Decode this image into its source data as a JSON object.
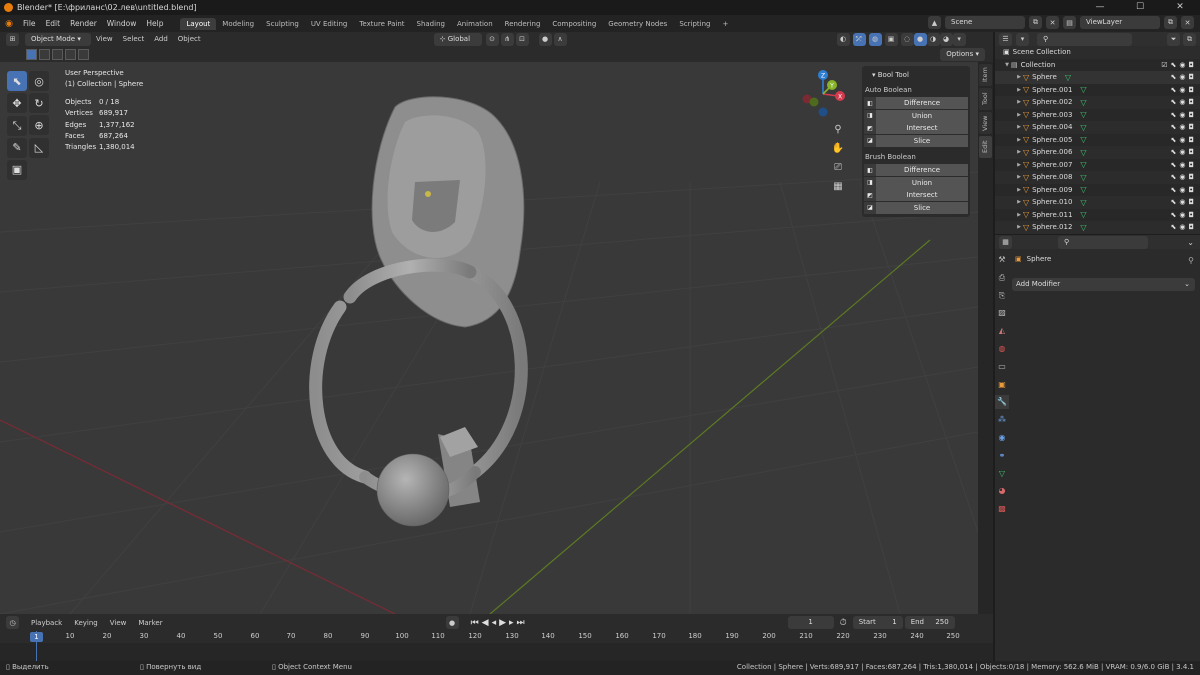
{
  "window": {
    "title": "Blender* [E:\\фриланс\\02.лев\\untitled.blend]",
    "minimize": "—",
    "maximize": "☐",
    "close": "✕"
  },
  "menu": {
    "items": [
      "File",
      "Edit",
      "Render",
      "Window",
      "Help"
    ]
  },
  "workspaces": [
    "Layout",
    "Modeling",
    "Sculpting",
    "UV Editing",
    "Texture Paint",
    "Shading",
    "Animation",
    "Rendering",
    "Compositing",
    "Geometry Nodes",
    "Scripting"
  ],
  "workspace_add": "+",
  "scene": {
    "label": "Scene",
    "viewlayer": "ViewLayer"
  },
  "viewport_header": {
    "mode": "Object Mode",
    "menus": [
      "View",
      "Select",
      "Add",
      "Object"
    ],
    "orientation": "Global",
    "options": "Options"
  },
  "overlay": {
    "view_name": "User Perspective",
    "context": "(1) Collection | Sphere"
  },
  "stats": [
    {
      "label": "Objects",
      "value": "0 / 18"
    },
    {
      "label": "Vertices",
      "value": "689,917"
    },
    {
      "label": "Edges",
      "value": "1,377,162"
    },
    {
      "label": "Faces",
      "value": "687,264"
    },
    {
      "label": "Triangles",
      "value": "1,380,014"
    }
  ],
  "gizmo": {
    "z": "Z",
    "x": "X",
    "y": "Y"
  },
  "bool_tool": {
    "title": "Bool Tool",
    "auto_label": "Auto Boolean",
    "brush_label": "Brush Boolean",
    "auto": [
      "Difference",
      "Union",
      "Intersect",
      "Slice"
    ],
    "brush": [
      "Difference",
      "Union",
      "Intersect",
      "Slice"
    ]
  },
  "ntabs": [
    "Item",
    "Tool",
    "View",
    "Edit"
  ],
  "outliner": {
    "root": "Scene Collection",
    "collection": "Collection",
    "items": [
      "Sphere",
      "Sphere.001",
      "Sphere.002",
      "Sphere.003",
      "Sphere.004",
      "Sphere.005",
      "Sphere.006",
      "Sphere.007",
      "Sphere.008",
      "Sphere.009",
      "Sphere.010",
      "Sphere.011",
      "Sphere.012"
    ]
  },
  "properties": {
    "object_name": "Sphere",
    "add_modifier": "Add Modifier"
  },
  "timeline": {
    "menus": [
      "Playback",
      "Keying",
      "View",
      "Marker"
    ],
    "current_frame": "1",
    "start_label": "Start",
    "start": "1",
    "end_label": "End",
    "end": "250",
    "ticks": [
      "10",
      "20",
      "30",
      "40",
      "50",
      "60",
      "70",
      "80",
      "90",
      "100",
      "110",
      "120",
      "130",
      "140",
      "150",
      "160",
      "170",
      "180",
      "190",
      "200",
      "210",
      "220",
      "230",
      "240",
      "250"
    ],
    "playhead_label": "1"
  },
  "status": {
    "select": "Выделить",
    "rotate": "Повернуть вид",
    "context": "Object Context Menu",
    "info": "Collection | Sphere | Verts:689,917 | Faces:687,264 | Tris:1,380,014 | Objects:0/18 | Memory: 562.6 MiB | VRAM: 0.9/6.0 GiB | 3.4.1"
  },
  "colors": {
    "accent": "#4772b3",
    "mesh": "#e89a3c",
    "data": "#3fc56e",
    "axis_x": "#d43a4e",
    "axis_y": "#86b32a",
    "axis_z": "#2e7fd4"
  }
}
